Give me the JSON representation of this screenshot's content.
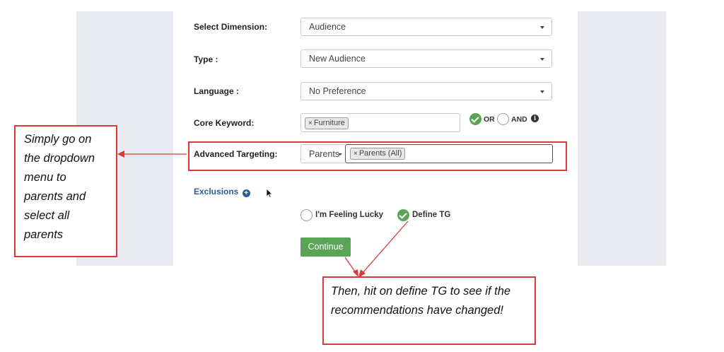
{
  "form": {
    "dimension": {
      "label": "Select Dimension:",
      "value": "Audience"
    },
    "type": {
      "label": "Type :",
      "value": "New Audience"
    },
    "language": {
      "label": "Language :",
      "value": "No Preference"
    },
    "core_keyword": {
      "label": "Core Keyword:",
      "tag": "Furniture",
      "remove_symbol": "×",
      "or_label": "OR",
      "and_label": "AND"
    },
    "advanced_targeting": {
      "label": "Advanced Targeting:",
      "category": "Parents",
      "tag": "Parents (All)",
      "remove_symbol": "×"
    },
    "exclusions": {
      "label": "Exclusions"
    },
    "mode_options": {
      "feeling_lucky": "I'm Feeling Lucky",
      "define_tg": "Define TG",
      "selected": "define_tg"
    },
    "continue_label": "Continue"
  },
  "annotations": {
    "left_note": "Simply go on the dropdown menu to parents and select all parents",
    "bottom_note": "Then, hit on define TG to see if the recommendations have changed!"
  },
  "colors": {
    "accent_green": "#5aa455",
    "annotation_red": "#d9393b",
    "link_blue": "#2c5c9c"
  }
}
